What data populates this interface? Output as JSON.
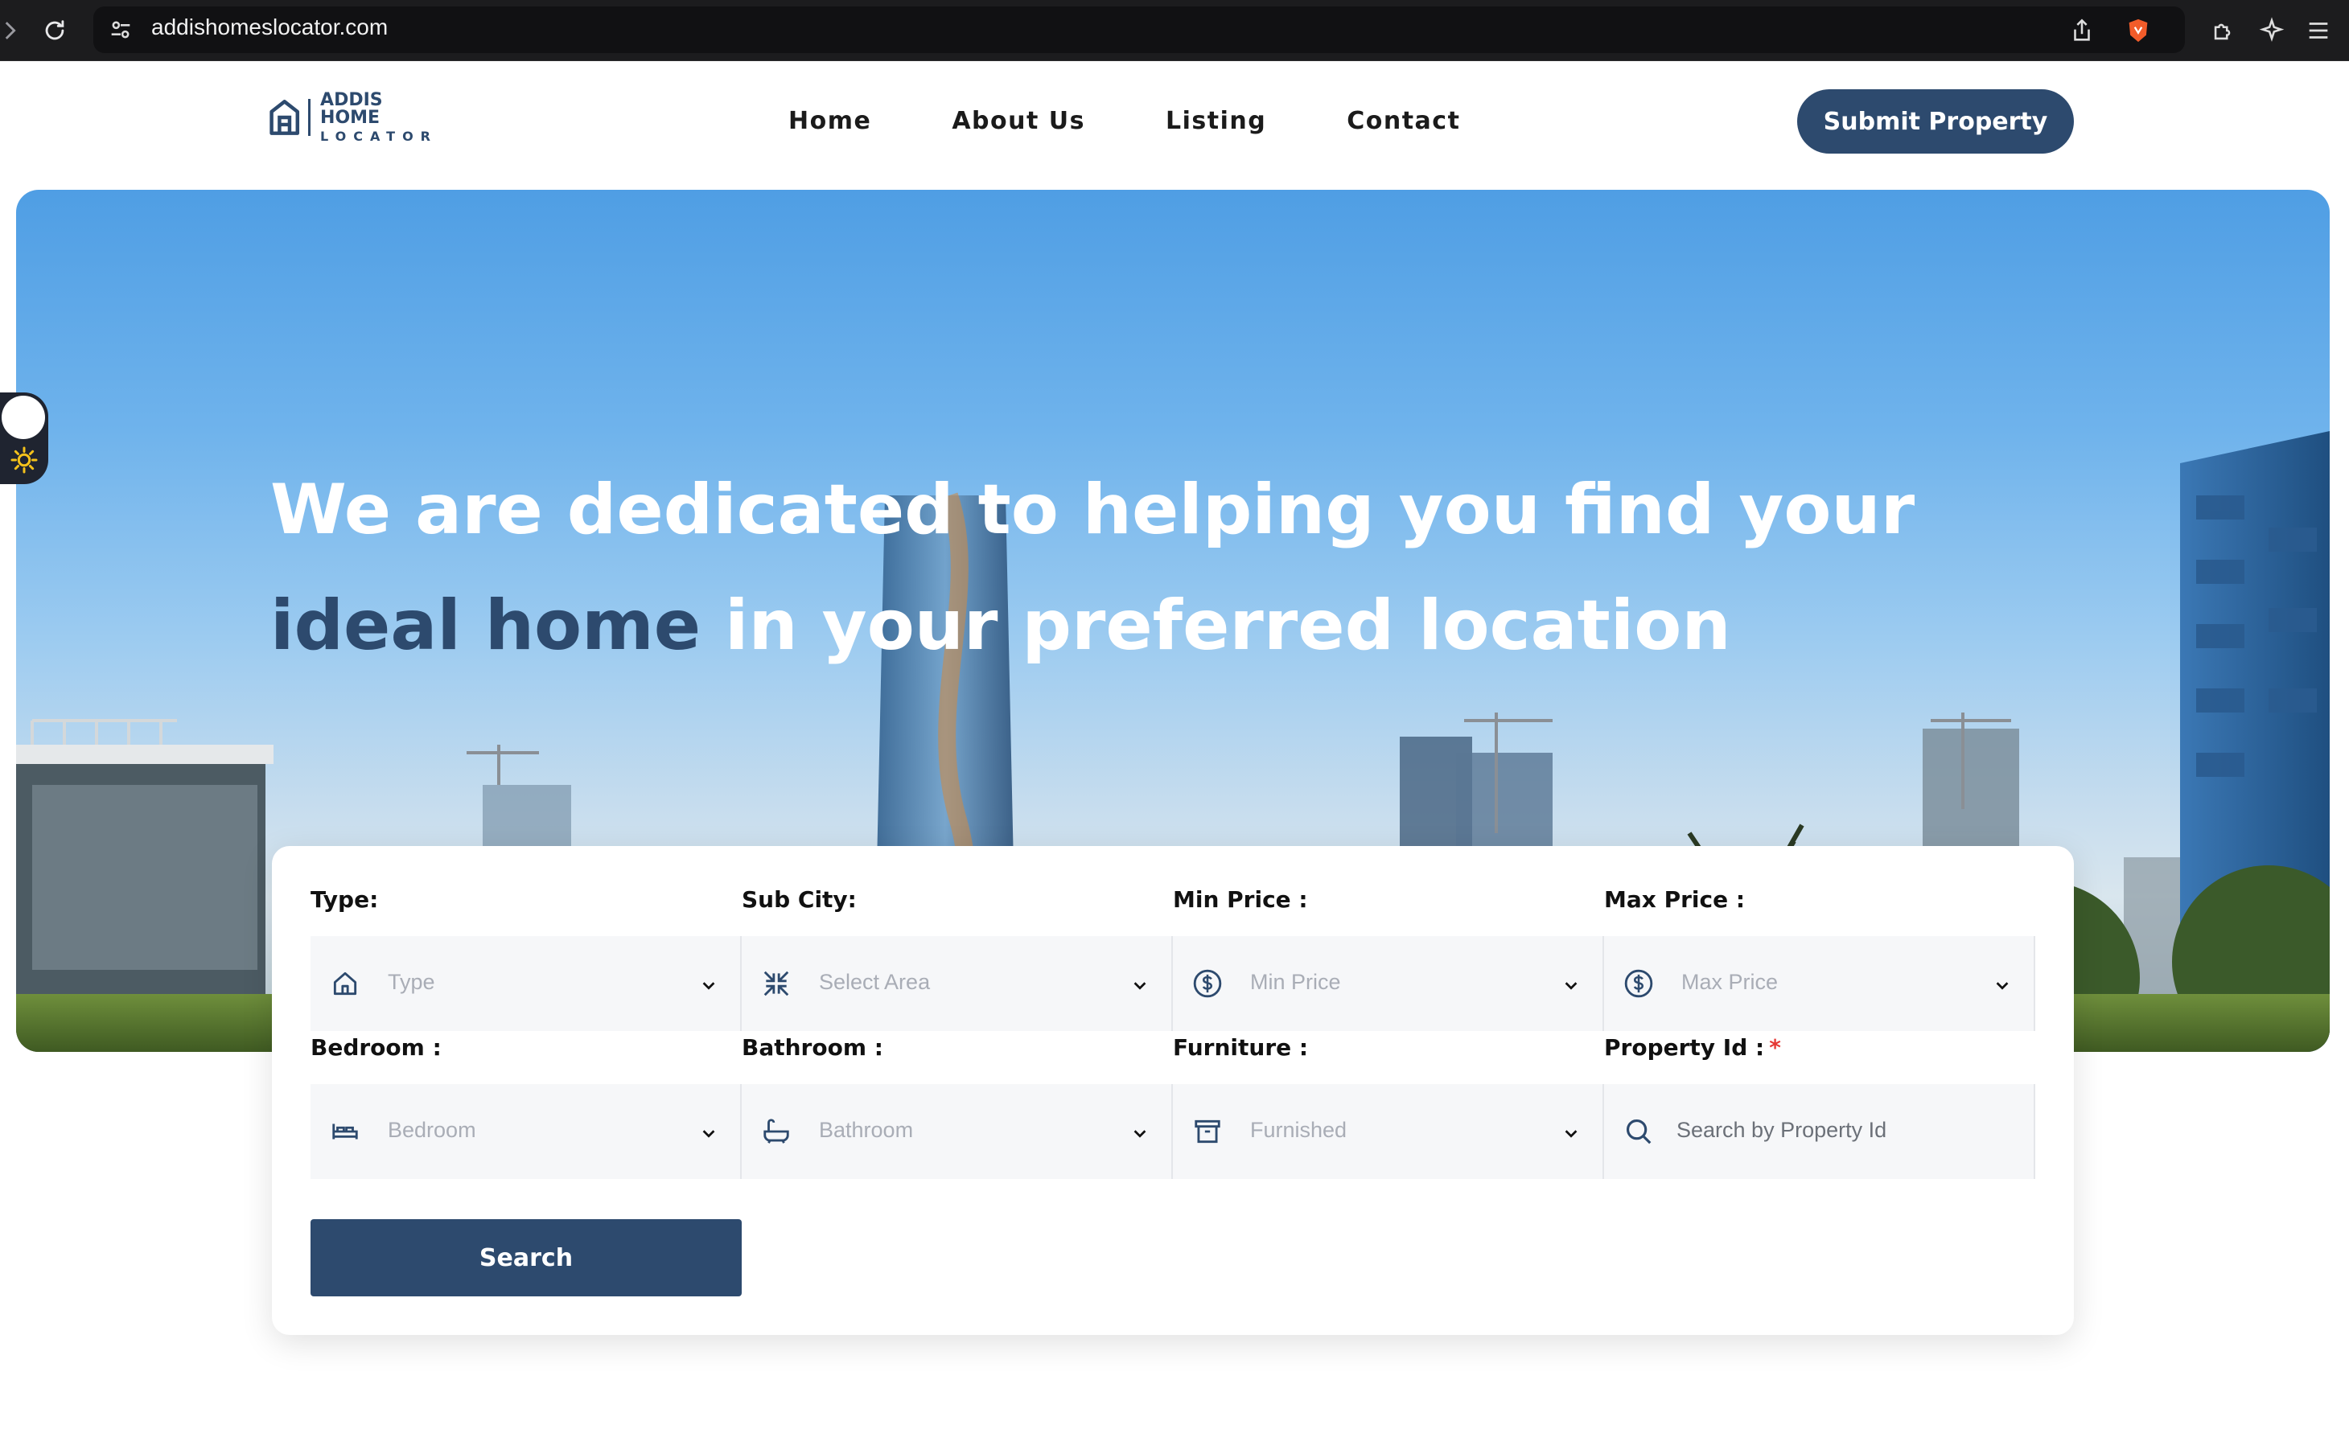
{
  "browser": {
    "url": "addishomeslocator.com"
  },
  "header": {
    "logo": {
      "line1": "ADDIS HOME",
      "line2": "LOCATOR"
    },
    "nav": [
      "Home",
      "About Us",
      "Listing",
      "Contact"
    ],
    "submit_label": "Submit Property"
  },
  "hero": {
    "title_part1": "We are dedicated to helping you find your ",
    "title_accent": "ideal home",
    "title_part2": " in your preferred location"
  },
  "search": {
    "fields": [
      {
        "label": "Type:",
        "placeholder": "Type",
        "icon": "home-icon"
      },
      {
        "label": "Sub City:",
        "placeholder": "Select Area",
        "icon": "compress-arrows-icon"
      },
      {
        "label": "Min Price :",
        "placeholder": "Min Price",
        "icon": "dollar-circle-icon"
      },
      {
        "label": "Max Price :",
        "placeholder": "Max Price",
        "icon": "dollar-circle-icon"
      },
      {
        "label": "Bedroom :",
        "placeholder": "Bedroom",
        "icon": "bed-icon"
      },
      {
        "label": "Bathroom :",
        "placeholder": "Bathroom",
        "icon": "bathtub-icon"
      },
      {
        "label": "Furniture :",
        "placeholder": "Furnished",
        "icon": "archive-box-icon"
      },
      {
        "label": "Property Id :",
        "required_mark": "*",
        "placeholder": "Search by Property Id",
        "icon": "search-icon"
      }
    ],
    "button_label": "Search"
  },
  "colors": {
    "brand": "#2d4a6e",
    "required": "#e53935",
    "browser_bar": "#1c1c1e"
  }
}
